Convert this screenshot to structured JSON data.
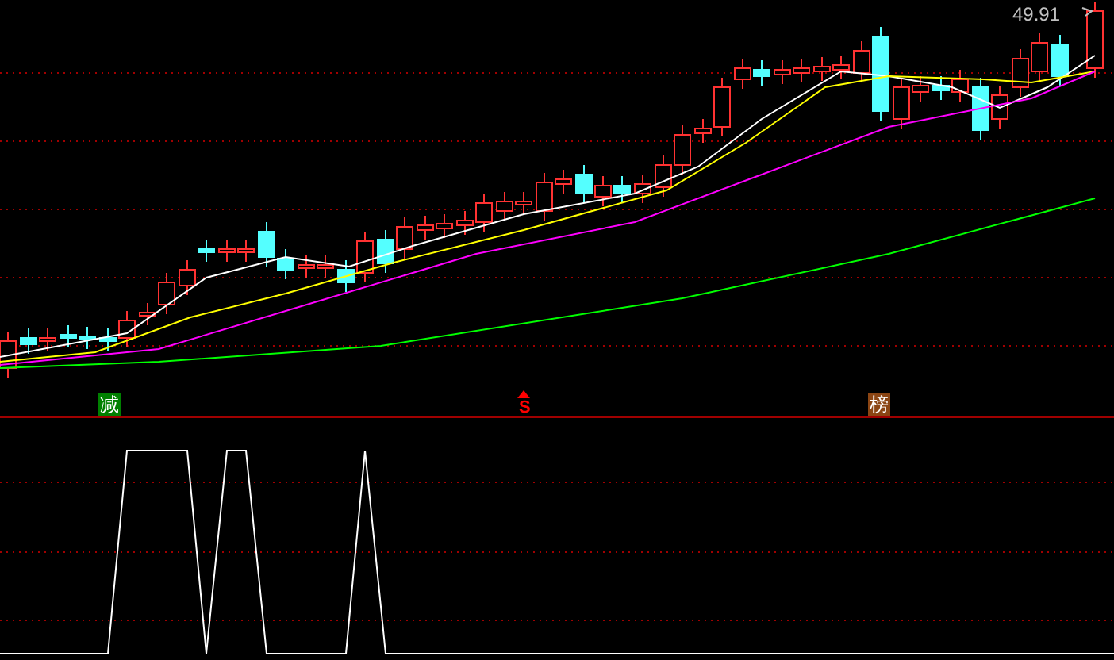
{
  "price_label": "49.91",
  "signals": [
    {
      "text": "减",
      "kind": "box",
      "color": "#008000"
    },
    {
      "text": "S",
      "kind": "arrow",
      "color": "#ff0000"
    },
    {
      "text": "榜",
      "kind": "box",
      "color": "#8b4513"
    }
  ]
}
